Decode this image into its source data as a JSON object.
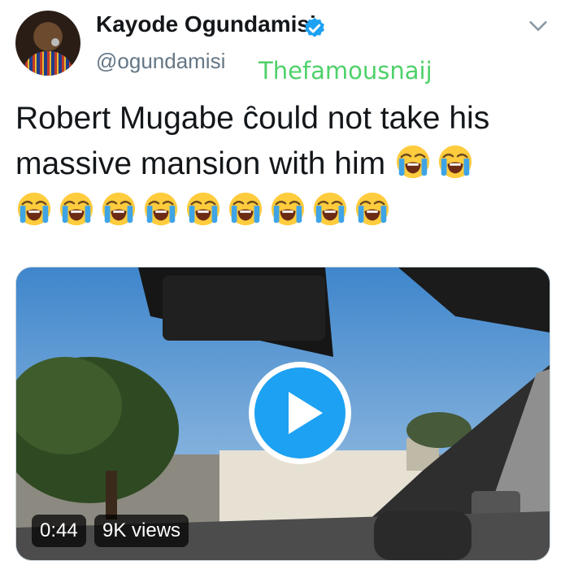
{
  "author": {
    "name": "Kayode Ogundamisi",
    "handle": "@ogundamisi",
    "verified": true
  },
  "watermark": "Thefamousnaij",
  "tweet": {
    "text": "Robert Mugabe c̑ould not take his massive mansion with him",
    "line1": "Robert Mugabe c̑ould not take his",
    "line2": "massive mansion with him",
    "emoji_inline_count": 2,
    "emoji_row_count": 9,
    "emoji_name": "loudly-crying-face-emoji"
  },
  "video": {
    "duration": "0:44",
    "views": "9K views"
  },
  "icons": {
    "verified": "verified-badge-icon",
    "menu": "chevron-down-icon",
    "play": "play-icon"
  },
  "colors": {
    "verified_blue": "#1da1f2",
    "handle_gray": "#657786",
    "watermark_green": "#4fd16a",
    "play_blue": "#1da1f2"
  }
}
